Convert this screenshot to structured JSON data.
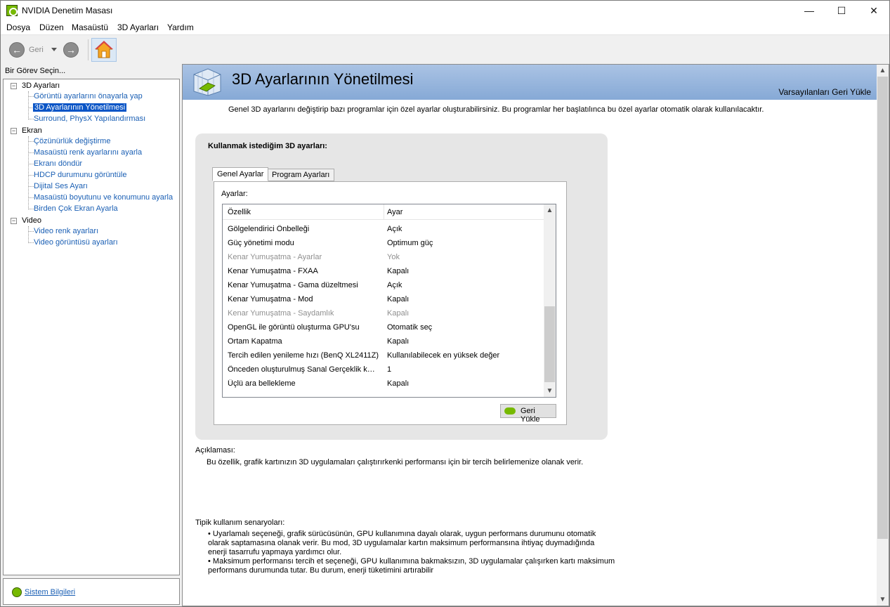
{
  "window": {
    "title": "NVIDIA Denetim Masası",
    "controls": {
      "minimize": "—",
      "maximize": "☐",
      "close": "✕"
    }
  },
  "menu": [
    "Dosya",
    "Düzen",
    "Masaüstü",
    "3D Ayarları",
    "Yardım"
  ],
  "toolbar": {
    "back_label": "Geri"
  },
  "left": {
    "heading": "Bir Görev Seçin...",
    "tree": [
      {
        "label": "3D Ayarları",
        "items": [
          "Görüntü ayarlarını önayarla yap",
          "3D Ayarlarının Yönetilmesi",
          "Surround, PhysX Yapılandırması"
        ]
      },
      {
        "label": "Ekran",
        "items": [
          "Çözünürlük değiştirme",
          "Masaüstü renk ayarlarını ayarla",
          "Ekranı döndür",
          "HDCP durumunu görüntüle",
          "Dijital Ses Ayarı",
          "Masaüstü boyutunu ve konumunu ayarla",
          "Birden Çok Ekran Ayarla"
        ]
      },
      {
        "label": "Video",
        "items": [
          "Video renk ayarları",
          "Video görüntüsü ayarları"
        ]
      }
    ],
    "selected": "3D Ayarlarının Yönetilmesi",
    "system_info": "Sistem Bilgileri"
  },
  "main": {
    "title": "3D Ayarlarının Yönetilmesi",
    "restore_defaults": "Varsayılanları Geri Yükle",
    "intro": "Genel 3D ayarlarını değiştirip bazı programlar için özel ayarlar oluşturabilirsiniz. Bu programlar her başlatılınca bu özel ayarlar otomatik olarak kullanılacaktır.",
    "settings_heading": "Kullanmak istediğim 3D ayarları:",
    "tabs": [
      "Genel Ayarlar",
      "Program Ayarları"
    ],
    "settings_label": "Ayarlar:",
    "columns": [
      "Özellik",
      "Ayar"
    ],
    "rows": [
      {
        "property": "Gölgelendirici Önbelleği",
        "value": "Açık",
        "disabled": false
      },
      {
        "property": "Güç yönetimi modu",
        "value": "Optimum güç",
        "disabled": false
      },
      {
        "property": "Kenar Yumuşatma - Ayarlar",
        "value": "Yok",
        "disabled": true
      },
      {
        "property": "Kenar Yumuşatma - FXAA",
        "value": "Kapalı",
        "disabled": false
      },
      {
        "property": "Kenar Yumuşatma - Gama düzeltmesi",
        "value": "Açık",
        "disabled": false
      },
      {
        "property": "Kenar Yumuşatma - Mod",
        "value": "Kapalı",
        "disabled": false
      },
      {
        "property": "Kenar Yumuşatma - Saydamlık",
        "value": "Kapalı",
        "disabled": true
      },
      {
        "property": "OpenGL ile görüntü oluşturma GPU'su",
        "value": "Otomatik seç",
        "disabled": false
      },
      {
        "property": "Ortam Kapatma",
        "value": "Kapalı",
        "disabled": false
      },
      {
        "property": "Tercih edilen yenileme hızı (BenQ XL2411Z)",
        "value": "Kullanılabilecek en yüksek değer",
        "disabled": false
      },
      {
        "property": "Önceden oluşturulmuş Sanal Gerçeklik karelerinin sayısı",
        "value": "1",
        "disabled": false
      },
      {
        "property": "Üçlü ara bellekleme",
        "value": "Kapalı",
        "disabled": false
      }
    ],
    "restore_button": "Geri Yükle",
    "description_label": "Açıklaması:",
    "description": "Bu özellik, grafik kartınızın 3D uygulamaları çalıştırırkenki performansı için bir tercih belirlemenize olanak verir.",
    "typical_label": "Tipik kullanım senaryoları:",
    "typical": [
      "• Uyarlamalı seçeneği, grafik sürücüsünün, GPU kullanımına dayalı olarak, uygun performans durumunu otomatik olarak saptamasına olanak verir. Bu mod, 3D uygulamalar kartın maksimum performansına ihtiyaç duymadığında enerji tasarrufu yapmaya yardımcı olur.",
      "• Maksimum performansı tercih et seçeneği, GPU kullanımına bakmaksızın, 3D uygulamalar çalışırken kartı maksimum performans durumunda tutar. Bu durum, enerji tüketimini artırabilir"
    ]
  },
  "colors": {
    "link": "#1a5fb4",
    "selection": "#0a55c6",
    "nvidia_green": "#76b900",
    "banner": "#9bb9e0"
  },
  "icons": [
    "nvidia-logo-icon",
    "back-arrow-icon",
    "forward-arrow-icon",
    "home-icon",
    "3d-settings-icon",
    "restore-icon",
    "system-info-icon"
  ]
}
